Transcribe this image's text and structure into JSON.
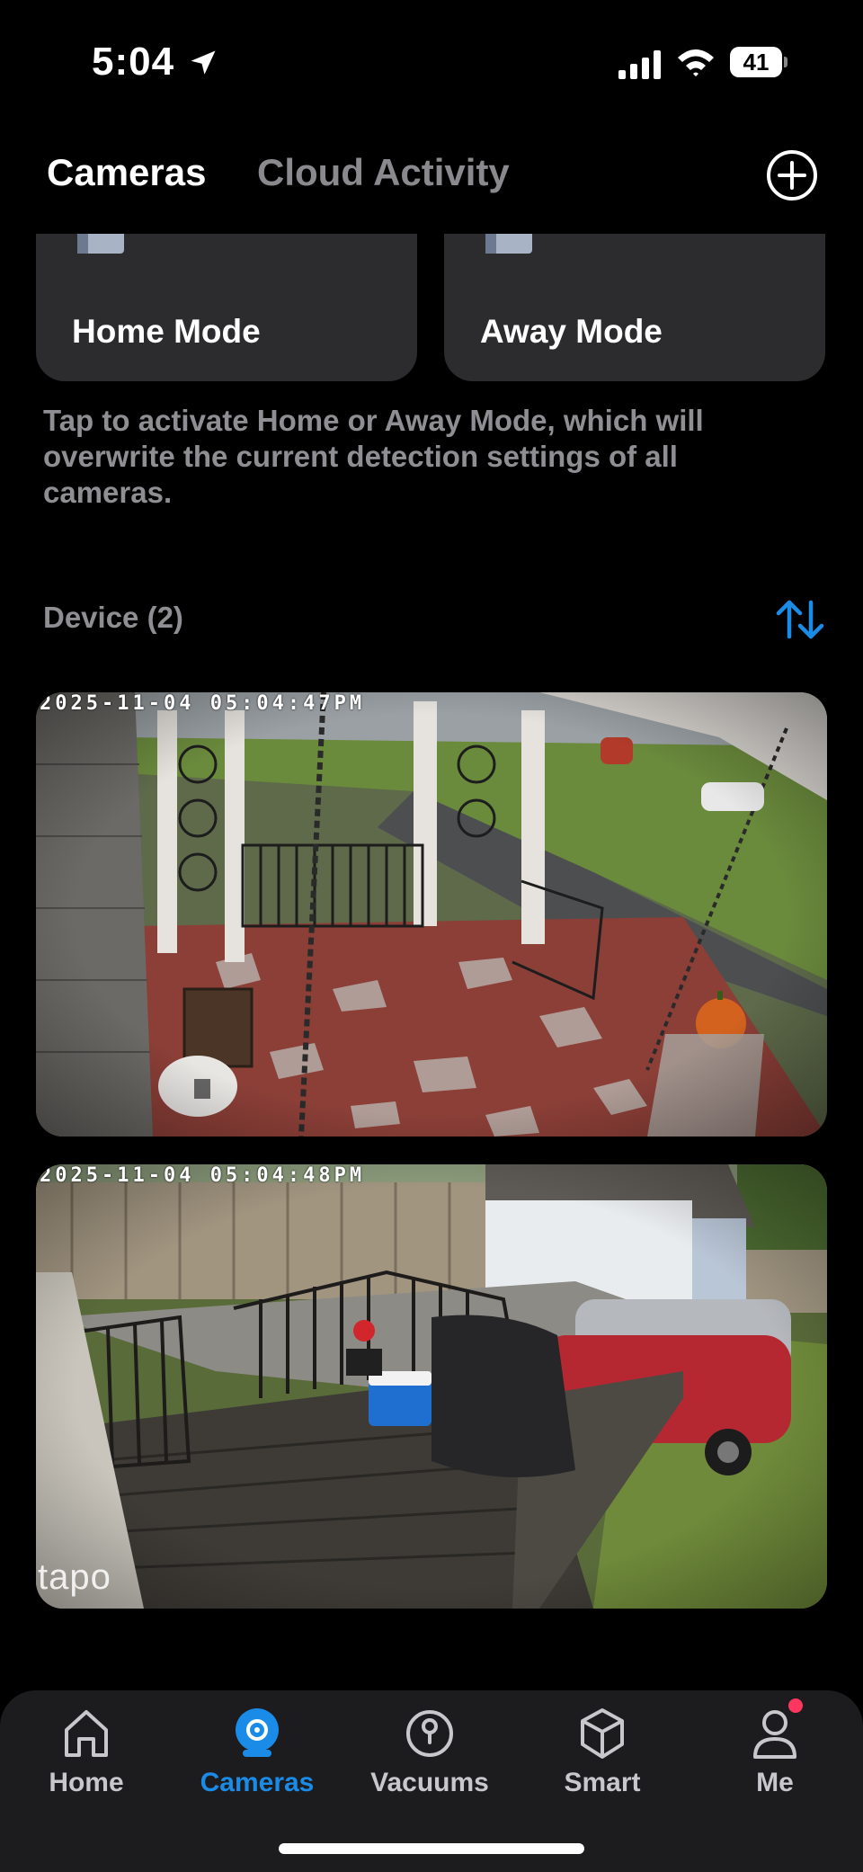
{
  "status_bar": {
    "time": "5:04",
    "battery": "41"
  },
  "header": {
    "tabs": [
      {
        "label": "Cameras",
        "active": true
      },
      {
        "label": "Cloud Activity",
        "active": false
      }
    ],
    "add_icon": "plus-circle-icon"
  },
  "modes": {
    "home_label": "Home Mode",
    "away_label": "Away Mode",
    "help_text": "Tap to activate Home or Away Mode, which will overwrite the current detection settings of all cameras."
  },
  "devices": {
    "header": "Device (2)",
    "sort_icon": "sort-arrows-icon",
    "cameras": [
      {
        "timestamp": "2025-11-04 05:04:47PM",
        "scene": "front porch"
      },
      {
        "timestamp": "2025-11-04 05:04:48PM",
        "scene": "back deck",
        "watermark": "tapo"
      }
    ]
  },
  "tab_bar": {
    "items": [
      {
        "label": "Home",
        "icon": "house-icon"
      },
      {
        "label": "Cameras",
        "icon": "camera-icon",
        "active": true
      },
      {
        "label": "Vacuums",
        "icon": "vacuum-icon"
      },
      {
        "label": "Smart",
        "icon": "cube-icon"
      },
      {
        "label": "Me",
        "icon": "person-icon",
        "badge": true
      }
    ]
  },
  "colors": {
    "accent": "#1a8ce8",
    "background": "#000000",
    "card": "#2c2c2e",
    "secondary_text": "#8e8e93",
    "badge": "#ff375f"
  }
}
